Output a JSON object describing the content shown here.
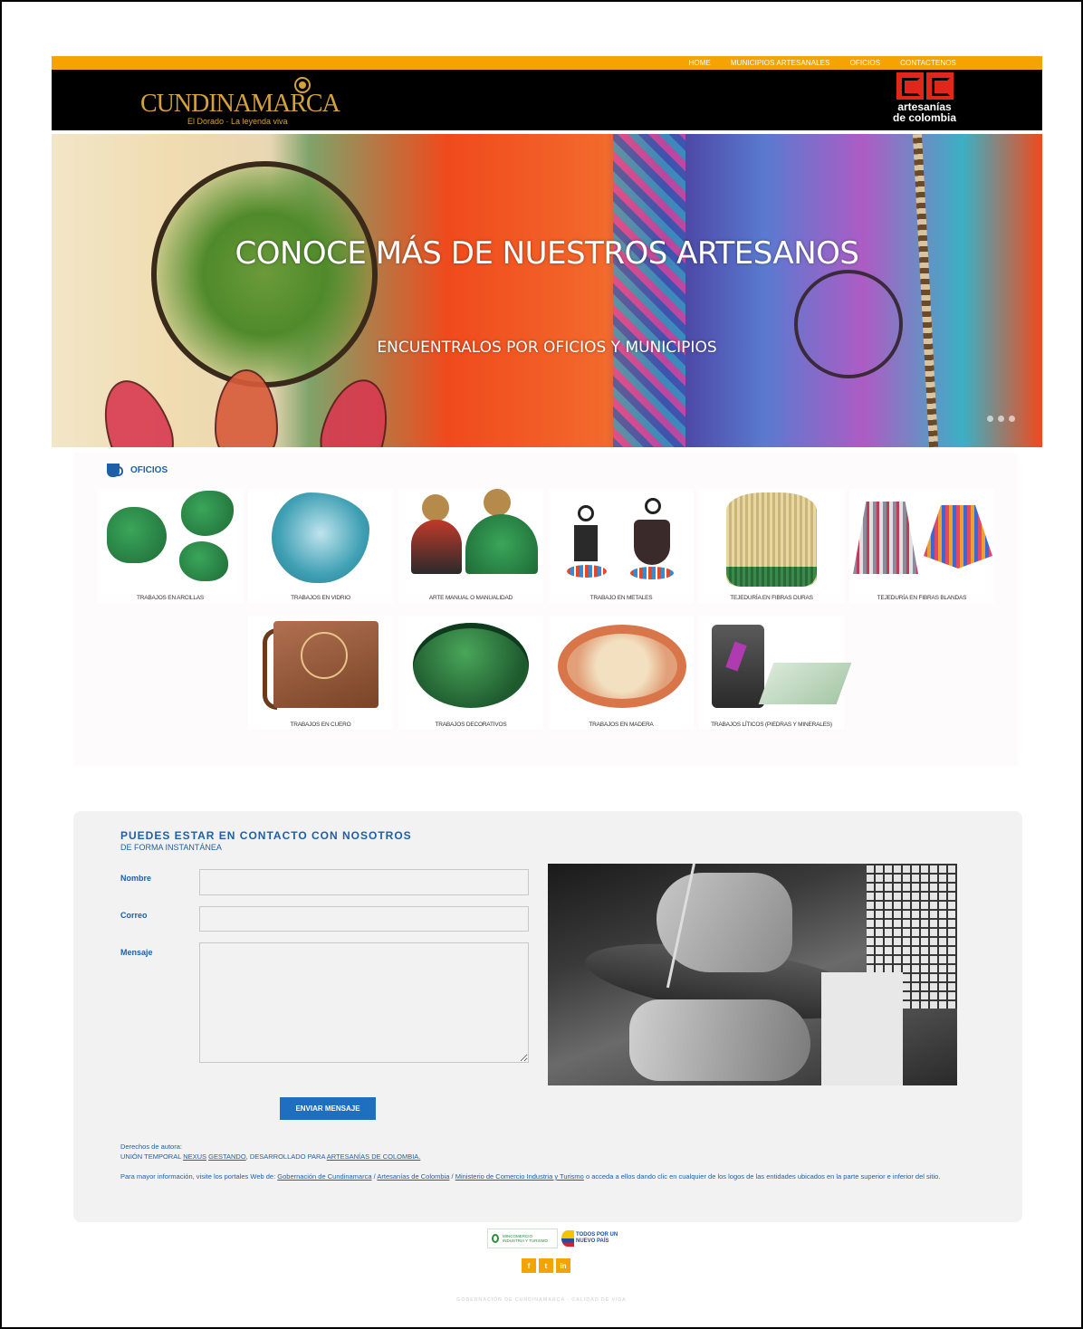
{
  "nav": {
    "items": [
      "HOME",
      "MUNICIPIOS ARTESANALES",
      "OFICIOS",
      "CONTACTENOS"
    ]
  },
  "brand": {
    "cundinamarca_logo": "CUNDINAMARCA",
    "cundinamarca_tagline": "El Dorado · La leyenda viva",
    "artesanias_line1": "artesanías",
    "artesanias_line2": "de colombia"
  },
  "hero": {
    "title": "CONOCE MÁS DE NUESTROS ARTESANOS",
    "subtitle": "ENCUENTRALOS POR OFICIOS Y MUNICIPIOS"
  },
  "oficios": {
    "heading": "OFICIOS",
    "items": [
      "TRABAJOS EN ARCILLAS",
      "TRABAJOS EN VIDRIO",
      "ARTE MANUAL O MANUALIDAD",
      "TRABAJO EN METALES",
      "TEJEDURÍA EN FIBRAS DURAS",
      "TEJEDURÍA EN FIBRAS BLANDAS",
      "TRABAJOS EN CUERO",
      "TRABAJOS DECORATIVOS",
      "TRABAJOS EN MADERA",
      "TRABAJOS LÍTICOS (PIEDRAS Y MINERALES)"
    ]
  },
  "contact": {
    "title": "PUEDES ESTAR EN CONTACTO CON NOSOTROS",
    "subtitle": "DE FORMA INSTANTÁNEA",
    "name_label": "Nombre",
    "email_label": "Correo",
    "message_label": "Mensaje",
    "name_value": "",
    "email_value": "",
    "message_value": "",
    "send_label": "ENVIAR MENSAJE",
    "rights_label": "Derechos de autora:",
    "rights_prefix": "UNIÓN TEMPORAL",
    "rights_link1": "NEXUS",
    "rights_link2": "GESTANDO",
    "rights_middle": ", DESARROLLADO PARA",
    "rights_link3": "ARTESANÍAS DE COLOMBIA.",
    "info_prefix": "Para mayor información, visite los portales Web de:",
    "info_link1": "Gobernación de Cundinamarca",
    "info_sep1": "/",
    "info_link2": "Artesanías de Colombia",
    "info_sep2": "/",
    "info_link3": "Ministerio de Comercio Industria y Turismo",
    "info_suffix": "o acceda a ellos dando clic en cualquier de los logos de las entidades ubicados en la parte superior e inferior del sitio."
  },
  "footer": {
    "mincomercio": "MINCOMERCIO INDUSTRIA Y TURISMO",
    "todos_line1": "TODOS POR UN",
    "todos_line2": "NUEVO PAÍS",
    "social": [
      "f",
      "t",
      "in"
    ],
    "bottom_text": "GOBERNACIÓN DE CUNDINAMARCA - CALIDAD DE VIDA"
  },
  "colors": {
    "accent_orange": "#f5a300",
    "brand_blue": "#1e5fa8",
    "button_blue": "#1e6fc0"
  }
}
